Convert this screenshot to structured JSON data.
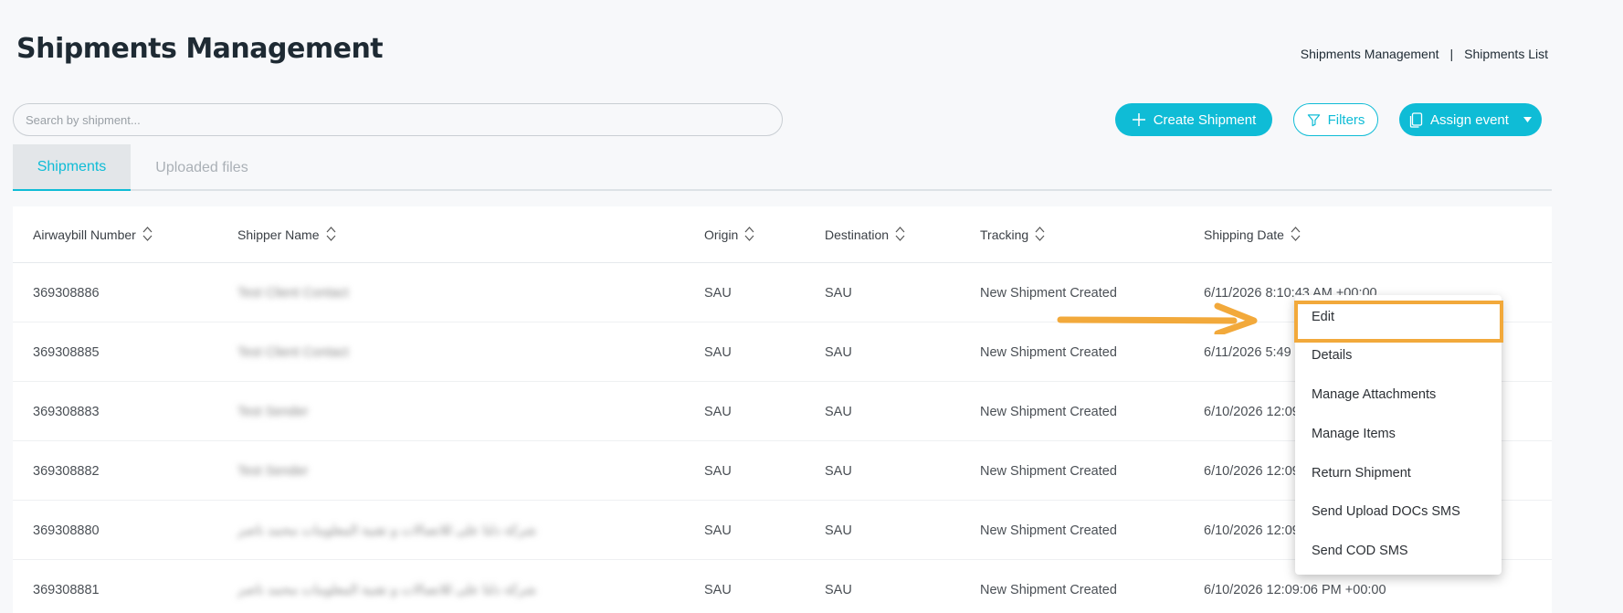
{
  "header": {
    "title": "Shipments Management",
    "breadcrumb": [
      "Shipments Management",
      "|",
      "Shipments List"
    ]
  },
  "search": {
    "placeholder": "Search by shipment..."
  },
  "toolbar": {
    "create_label": "Create Shipment",
    "filters_label": "Filters",
    "assign_label": "Assign event"
  },
  "tabs": [
    {
      "label": "Shipments",
      "active": true
    },
    {
      "label": "Uploaded files",
      "active": false
    }
  ],
  "table": {
    "columns": [
      "Airwaybill Number",
      "Shipper Name",
      "Origin",
      "Destination",
      "Tracking",
      "Shipping Date"
    ],
    "rows": [
      {
        "awb": "369308886",
        "shipper": "Test Client Contact",
        "origin": "SAU",
        "destination": "SAU",
        "tracking": "New Shipment Created",
        "date": "6/11/2026 8:10:43 AM +00:00"
      },
      {
        "awb": "369308885",
        "shipper": "Test Client Contact",
        "origin": "SAU",
        "destination": "SAU",
        "tracking": "New Shipment Created",
        "date": "6/11/2026 5:49"
      },
      {
        "awb": "369308883",
        "shipper": "Test Sender",
        "origin": "SAU",
        "destination": "SAU",
        "tracking": "New Shipment Created",
        "date": "6/10/2026 12:09"
      },
      {
        "awb": "369308882",
        "shipper": "Test Sender",
        "origin": "SAU",
        "destination": "SAU",
        "tracking": "New Shipment Created",
        "date": "6/10/2026 12:09"
      },
      {
        "awb": "369308880",
        "shipper": "شركة دلتا على للاتصالات و تقنية المعلومات محمد ناصر",
        "origin": "SAU",
        "destination": "SAU",
        "tracking": "New Shipment Created",
        "date": "6/10/2026 12:09"
      },
      {
        "awb": "369308881",
        "shipper": "شركة دلتا على للاتصالات و تقنية المعلومات محمد ناصر",
        "origin": "SAU",
        "destination": "SAU",
        "tracking": "New Shipment Created",
        "date": "6/10/2026 12:09:06 PM +00:00"
      }
    ]
  },
  "context_menu": {
    "items": [
      "Edit",
      "Details",
      "Manage Attachments",
      "Manage Items",
      "Return Shipment",
      "Send Upload DOCs SMS",
      "Send COD SMS"
    ],
    "highlighted": "Edit"
  },
  "colors": {
    "accent": "#0fbcd6",
    "highlight": "#f2a93b",
    "background": "#f7f8fa"
  }
}
